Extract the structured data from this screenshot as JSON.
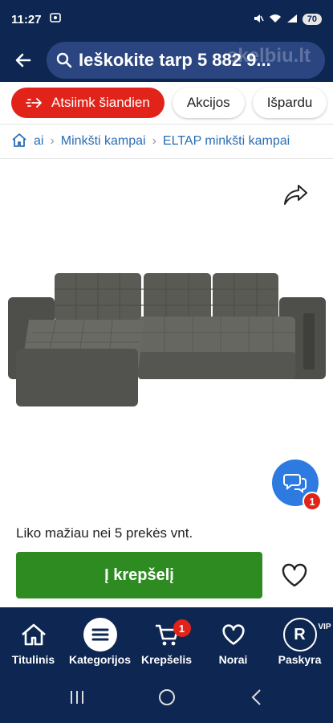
{
  "status_bar": {
    "time": "11:27",
    "battery": "70"
  },
  "header": {
    "search_text": "Ieškokite tarp 5 882 9...",
    "brand": "skelbiu.lt"
  },
  "chips": [
    {
      "label": "Atsiimk šiandien"
    },
    {
      "label": "Akcijos"
    },
    {
      "label": "Išpardu"
    }
  ],
  "breadcrumb": {
    "items": [
      "ai",
      "Minkšti kampai",
      "ELTAP minkšti kampai"
    ]
  },
  "chat": {
    "badge": "1"
  },
  "buy": {
    "stock_text": "Liko mažiau nei 5 prekės vnt.",
    "cart_button": "Į krepšelį"
  },
  "bottom_nav": {
    "items": [
      {
        "label": "Titulinis",
        "icon": "home-icon"
      },
      {
        "label": "Kategorijos",
        "icon": "menu-icon"
      },
      {
        "label": "Krepšelis",
        "icon": "cart-icon",
        "badge": "1"
      },
      {
        "label": "Norai",
        "icon": "heart-icon"
      },
      {
        "label": "Paskyra",
        "icon": "profile-icon",
        "avatar": "R",
        "tag": "VIP"
      }
    ]
  },
  "colors": {
    "navy": "#0e2752",
    "red": "#e2231a",
    "green": "#2e8b22",
    "blue": "#2d7be0"
  }
}
